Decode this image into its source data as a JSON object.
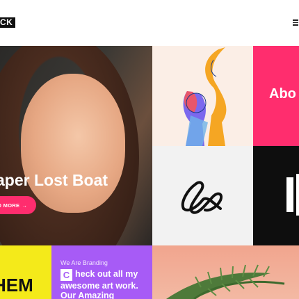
{
  "header": {
    "logo_text": "CK",
    "menu_icon": "hamburger-icon"
  },
  "hero": {
    "title": "aper Lost Boat",
    "cta_label": "AD MORE",
    "cta_icon": "arrow-right-icon"
  },
  "about": {
    "label": "Abo"
  },
  "branding": {
    "subtitle": "We Are Branding",
    "cap_letter": "C",
    "heading": "heck out all my awesome art work. Our Amazing"
  },
  "yellow_panel": {
    "text": "HEM"
  },
  "colors": {
    "accent_pink": "#ff2d6e",
    "purple": "#a75bf6",
    "yellow": "#f4ea1a",
    "black": "#0e0e0e"
  }
}
